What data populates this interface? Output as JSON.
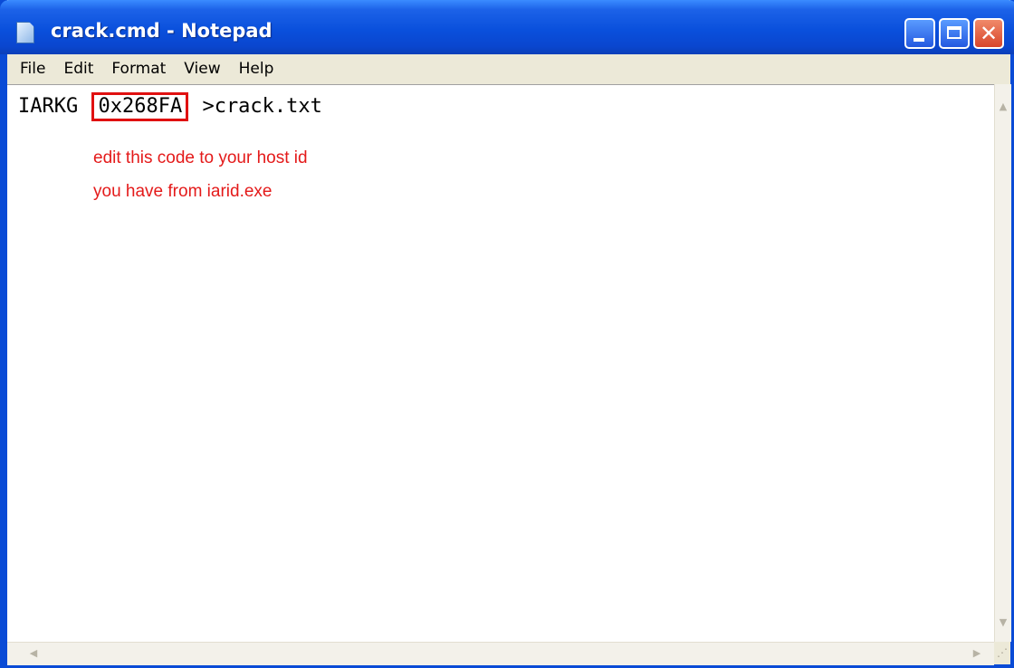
{
  "window": {
    "title": "crack.cmd - Notepad",
    "icon": "notepad-icon",
    "accent_color": "#0a50dc",
    "close_color": "#d8452a"
  },
  "menubar": {
    "items": [
      {
        "label": "File"
      },
      {
        "label": "Edit"
      },
      {
        "label": "Format"
      },
      {
        "label": "View"
      },
      {
        "label": "Help"
      }
    ]
  },
  "editor": {
    "line1_prefix": "IARKG ",
    "host_id": "0x268FA",
    "line1_suffix": " >crack.txt",
    "highlight_color": "#e01010"
  },
  "annotation": {
    "line1": "edit this code to your host id",
    "line2": "you have from iarid.exe",
    "color": "#e41a1a"
  }
}
